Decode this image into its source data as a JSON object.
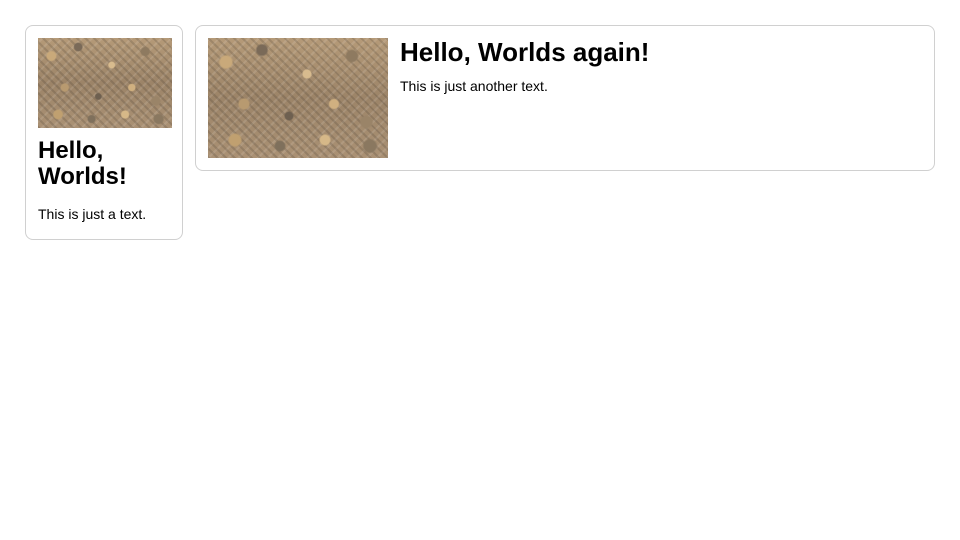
{
  "cards": [
    {
      "image_alt": "firewood-texture",
      "title": "Hello, Worlds!",
      "body": "This is just a text."
    },
    {
      "image_alt": "firewood-texture",
      "title": "Hello, Worlds again!",
      "body": "This is just another text."
    }
  ]
}
